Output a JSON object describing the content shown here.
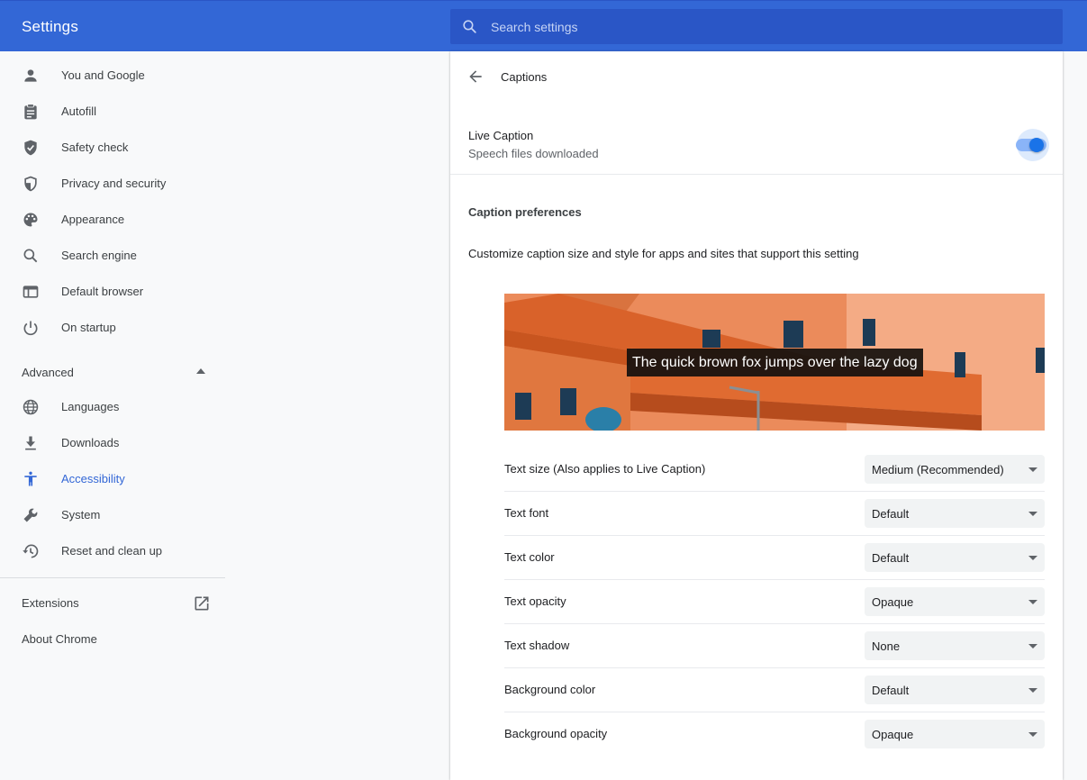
{
  "header": {
    "title": "Settings",
    "search_placeholder": "Search settings"
  },
  "sidebar": {
    "items": [
      {
        "label": "You and Google",
        "icon": "person-icon"
      },
      {
        "label": "Autofill",
        "icon": "clipboard-icon"
      },
      {
        "label": "Safety check",
        "icon": "shield-check-icon"
      },
      {
        "label": "Privacy and security",
        "icon": "shield-half-icon"
      },
      {
        "label": "Appearance",
        "icon": "palette-icon"
      },
      {
        "label": "Search engine",
        "icon": "search-icon"
      },
      {
        "label": "Default browser",
        "icon": "browser-window-icon"
      },
      {
        "label": "On startup",
        "icon": "power-icon"
      }
    ],
    "advanced_label": "Advanced",
    "advanced_items": [
      {
        "label": "Languages",
        "icon": "globe-icon"
      },
      {
        "label": "Downloads",
        "icon": "download-icon"
      },
      {
        "label": "Accessibility",
        "icon": "accessibility-icon"
      },
      {
        "label": "System",
        "icon": "wrench-icon"
      },
      {
        "label": "Reset and clean up",
        "icon": "history-icon"
      }
    ],
    "extensions_label": "Extensions",
    "about_label": "About Chrome",
    "active_color": "#3367d6"
  },
  "main": {
    "title": "Captions",
    "live_caption": {
      "title": "Live Caption",
      "subtitle": "Speech files downloaded",
      "enabled": true
    },
    "preferences_heading": "Caption preferences",
    "preferences_desc": "Customize caption size and style for apps and sites that support this setting",
    "preview_caption": "The quick brown fox jumps over the lazy dog",
    "settings": [
      {
        "label": "Text size (Also applies to Live Caption)",
        "value": "Medium (Recommended)"
      },
      {
        "label": "Text font",
        "value": "Default"
      },
      {
        "label": "Text color",
        "value": "Default"
      },
      {
        "label": "Text opacity",
        "value": "Opaque"
      },
      {
        "label": "Text shadow",
        "value": "None"
      },
      {
        "label": "Background color",
        "value": "Default"
      },
      {
        "label": "Background opacity",
        "value": "Opaque"
      }
    ]
  },
  "colors": {
    "header_bg": "#3367d6",
    "accent": "#1a73e8"
  }
}
